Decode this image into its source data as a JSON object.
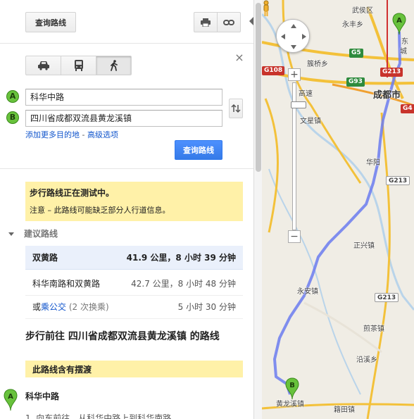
{
  "toolbar": {
    "search_label": "查询路线",
    "print_icon": "print-icon",
    "link_icon": "link-icon"
  },
  "modes": [
    {
      "name": "car",
      "icon": "car-icon",
      "active": false
    },
    {
      "name": "transit",
      "icon": "bus-icon",
      "active": false
    },
    {
      "name": "walk",
      "icon": "walk-icon",
      "active": true
    }
  ],
  "route_form": {
    "start_marker": "A",
    "start_value": "科华中路",
    "end_marker": "B",
    "end_value": "四川省成都双流县黄龙溪镇",
    "add_destination": "添加更多目的地",
    "separator": " - ",
    "advanced_options": "高级选项",
    "search_button": "查询路线"
  },
  "notice": {
    "title": "步行路线正在测试中。",
    "body": "注意 – 此路线可能缺乏部分人行道信息。"
  },
  "suggestions": {
    "heading": "建议路线",
    "routes": [
      {
        "name": "双黄路",
        "distance": "41.9 公里，8 小时 39 分钟"
      },
      {
        "name": "科华南路和双黄路",
        "distance": "42.7 公里，8 小时 48 分钟"
      },
      {
        "prefix": "或",
        "name": "乘公交",
        "note": "(2 次换乘)",
        "distance": "5 小时 30 分钟"
      }
    ]
  },
  "directions": {
    "title": "步行前往 四川省成都双流县黄龙溪镇 的路线",
    "ferry_note": "此路线含有摆渡",
    "start_marker": "A",
    "start_name": "科华中路",
    "cutoff_text": "1. 向东前往，从科华中路上到科华南路"
  },
  "map": {
    "labels": {
      "wuhou": "武侯区",
      "yongfeng": "永丰乡",
      "cuqiao": "簇桥乡",
      "chengdu": "成都市",
      "wenxing": "文星镇",
      "huayang": "华阳",
      "zhengxing": "正兴镇",
      "yongan": "永安镇",
      "jiancha": "煎茶镇",
      "yanxi": "沿溪乡",
      "huanglongxi": "黄龙溪镇",
      "jitian": "籍田镇",
      "gaosu": "高速",
      "dong": "东",
      "cheng": "城"
    },
    "shields": {
      "g5": "G5",
      "g93": "G93",
      "s108": "G108",
      "g213a": "G213",
      "g4": "G4",
      "g213b": "G213",
      "g213c": "G213"
    },
    "route_color": "#6b7bf0",
    "markers": {
      "start": "A",
      "end": "B"
    }
  }
}
